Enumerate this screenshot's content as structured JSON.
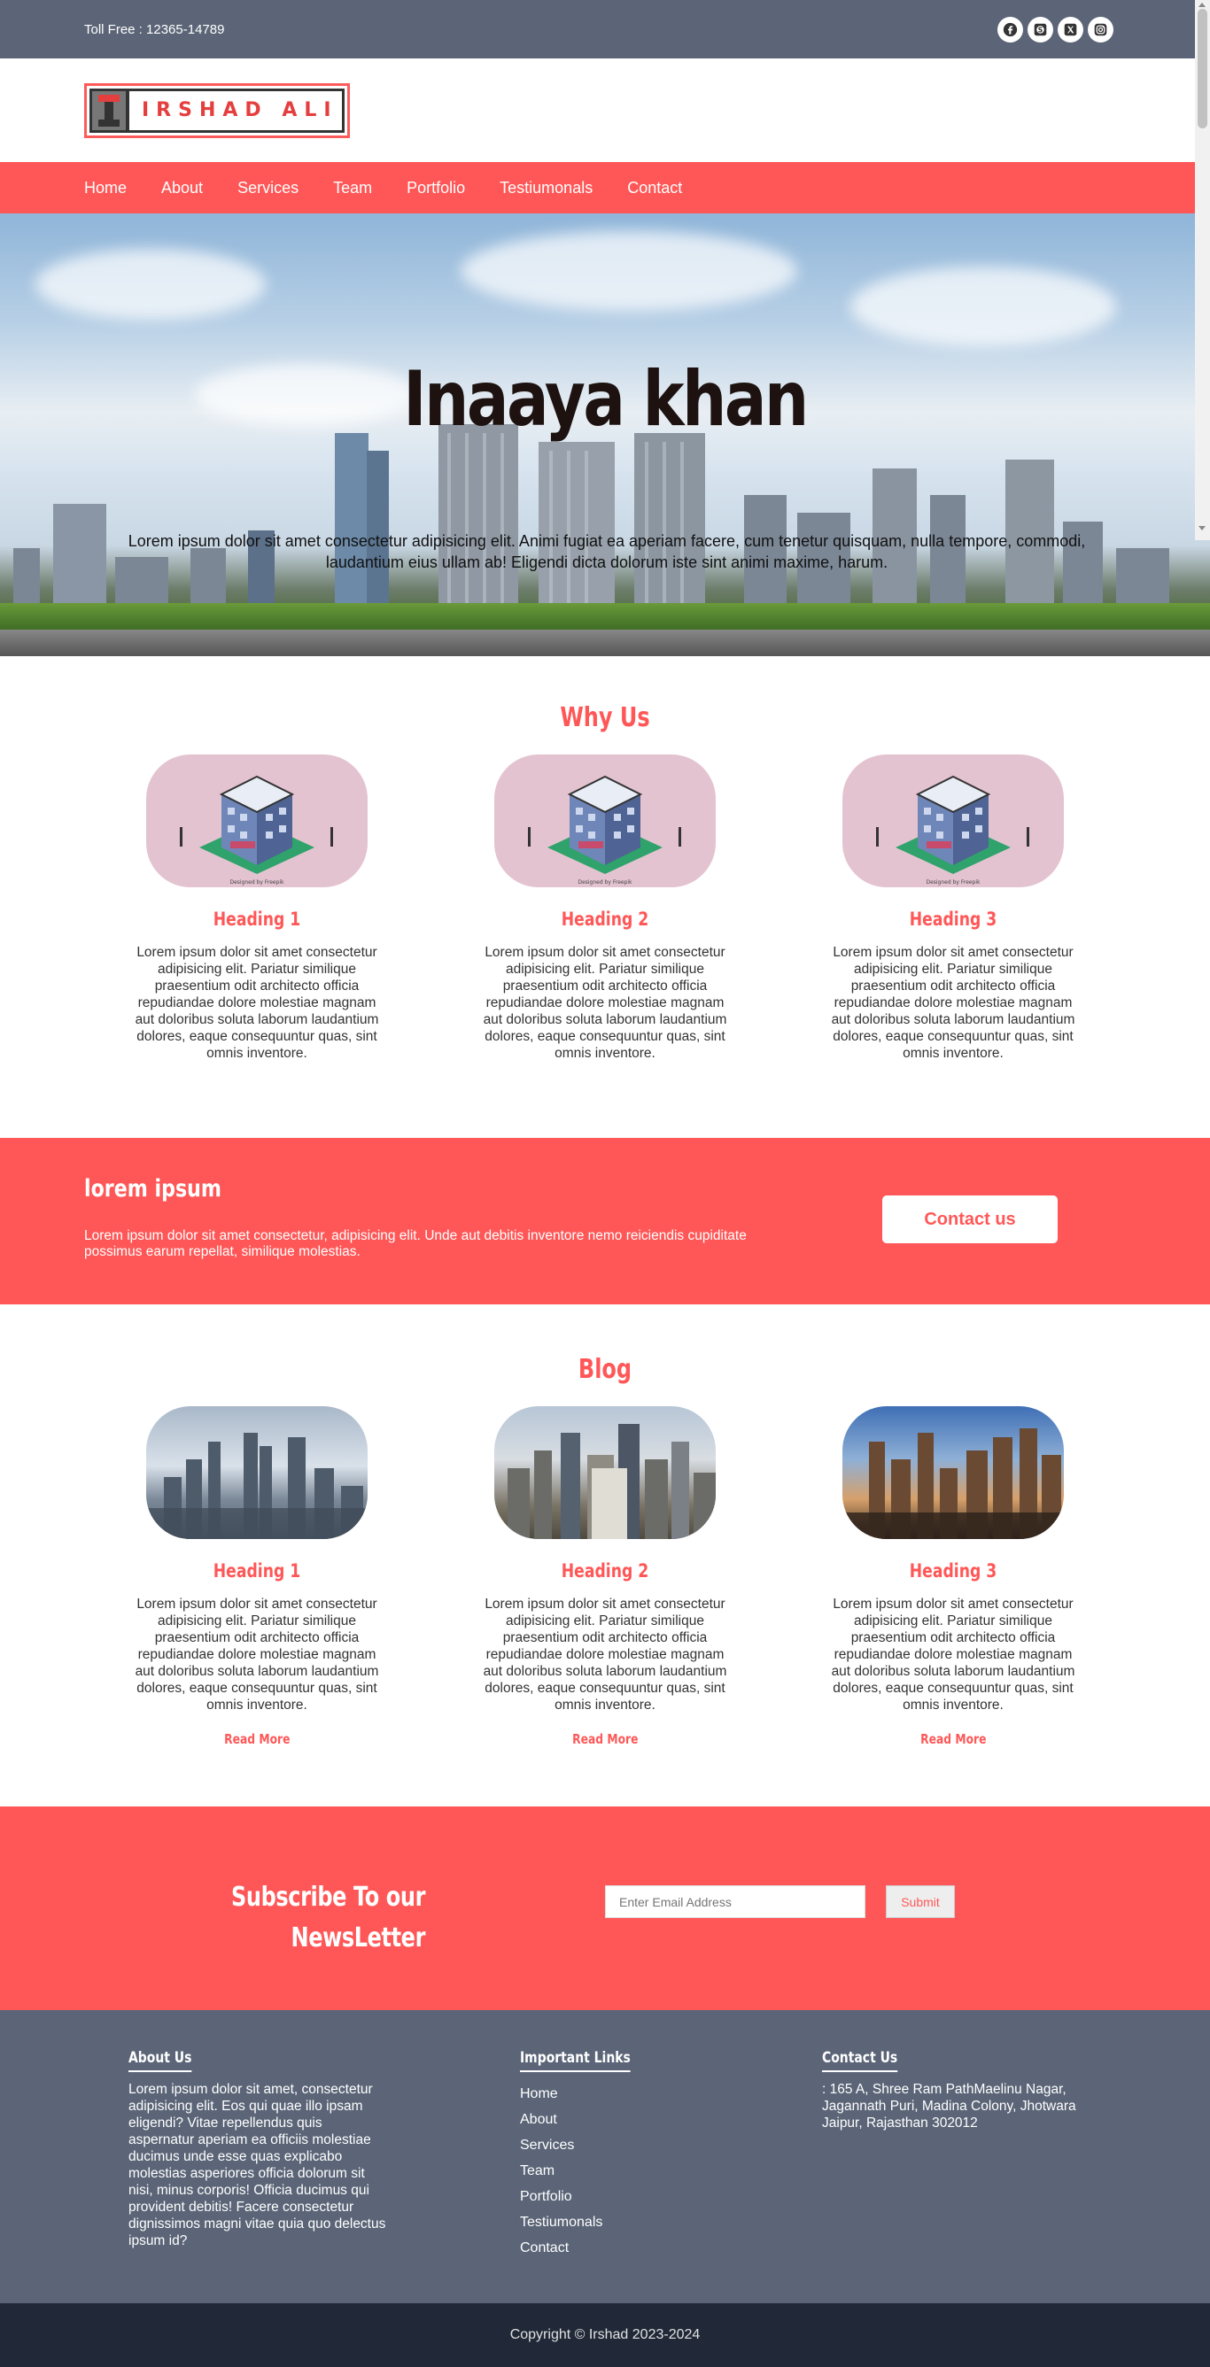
{
  "topbar": {
    "toll_free": "Toll Free : 12365-14789",
    "social_icons": [
      "facebook-icon",
      "skype-icon",
      "x-twitter-icon",
      "instagram-icon"
    ]
  },
  "logo": {
    "text": "IRSHAD ALI",
    "mark": "I"
  },
  "nav": {
    "items": [
      "Home",
      "About",
      "Services",
      "Team",
      "Portfolio",
      "Testiumonals",
      "Contact"
    ]
  },
  "hero": {
    "title": "Inaaya khan",
    "text": "Lorem ipsum dolor sit amet consectetur adipisicing elit. Animi fugiat ea aperiam facere, cum tenetur quisquam, nulla tempore, commodi, laudantium eius ullam ab! Eligendi dicta dolorum iste sint animi maxime, harum."
  },
  "why": {
    "title": "Why Us",
    "cards": [
      {
        "heading": "Heading 1",
        "text": "Lorem ipsum dolor sit amet consectetur adipisicing elit. Pariatur similique praesentium odit architecto officia repudiandae dolore molestiae magnam aut doloribus soluta laborum laudantium dolores, eaque consequuntur quas, sint omnis inventore."
      },
      {
        "heading": "Heading 2",
        "text": "Lorem ipsum dolor sit amet consectetur adipisicing elit. Pariatur similique praesentium odit architecto officia repudiandae dolore molestiae magnam aut doloribus soluta laborum laudantium dolores, eaque consequuntur quas, sint omnis inventore."
      },
      {
        "heading": "Heading 3",
        "text": "Lorem ipsum dolor sit amet consectetur adipisicing elit. Pariatur similique praesentium odit architecto officia repudiandae dolore molestiae magnam aut doloribus soluta laborum laudantium dolores, eaque consequuntur quas, sint omnis inventore."
      }
    ]
  },
  "cta": {
    "title": "lorem ipsum",
    "text": "Lorem ipsum dolor sit amet consectetur, adipisicing elit. Unde aut debitis inventore nemo reiciendis cupiditate possimus earum repellat, similique molestias.",
    "button": "Contact us"
  },
  "blog": {
    "title": "Blog",
    "read_more": "Read More",
    "cards": [
      {
        "heading": "Heading 1",
        "text": "Lorem ipsum dolor sit amet consectetur adipisicing elit. Pariatur similique praesentium odit architecto officia repudiandae dolore molestiae magnam aut doloribus soluta laborum laudantium dolores, eaque consequuntur quas, sint omnis inventore."
      },
      {
        "heading": "Heading 2",
        "text": "Lorem ipsum dolor sit amet consectetur adipisicing elit. Pariatur similique praesentium odit architecto officia repudiandae dolore molestiae magnam aut doloribus soluta laborum laudantium dolores, eaque consequuntur quas, sint omnis inventore."
      },
      {
        "heading": "Heading 3",
        "text": "Lorem ipsum dolor sit amet consectetur adipisicing elit. Pariatur similique praesentium odit architecto officia repudiandae dolore molestiae magnam aut doloribus soluta laborum laudantium dolores, eaque consequuntur quas, sint omnis inventore."
      }
    ]
  },
  "newsletter": {
    "title": "Subscribe To our NewsLetter",
    "placeholder": "Enter Email Address",
    "submit": "Submit"
  },
  "footer": {
    "about": {
      "title": "About Us",
      "text": "Lorem ipsum dolor sit amet, consectetur adipisicing elit. Eos qui quae illo ipsam eligendi? Vitae repellendus quis aspernatur aperiam ea officiis molestiae ducimus unde esse quas explicabo molestias asperiores officia dolorum sit nisi, minus corporis! Officia ducimus qui provident debitis! Facere consectetur dignissimos magni vitae quia quo delectus ipsum id?"
    },
    "links": {
      "title": "Important Links",
      "items": [
        "Home",
        "About",
        "Services",
        "Team",
        "Portfolio",
        "Testiumonals",
        "Contact"
      ]
    },
    "contact": {
      "title": "Contact Us",
      "address_line1": ": 165 A, Shree Ram PathMaelinu Nagar, Jagannath Puri, Madina Colony, Jhotwara",
      "address_line2": "Jaipur, Rajasthan 302012"
    },
    "copyright": "Copyright © Irshad 2023-2024"
  },
  "colors": {
    "accent": "#ff5757",
    "topbar": "#5b6577",
    "footer_bottom": "#212938",
    "card_bg": "#e4c3d0"
  }
}
